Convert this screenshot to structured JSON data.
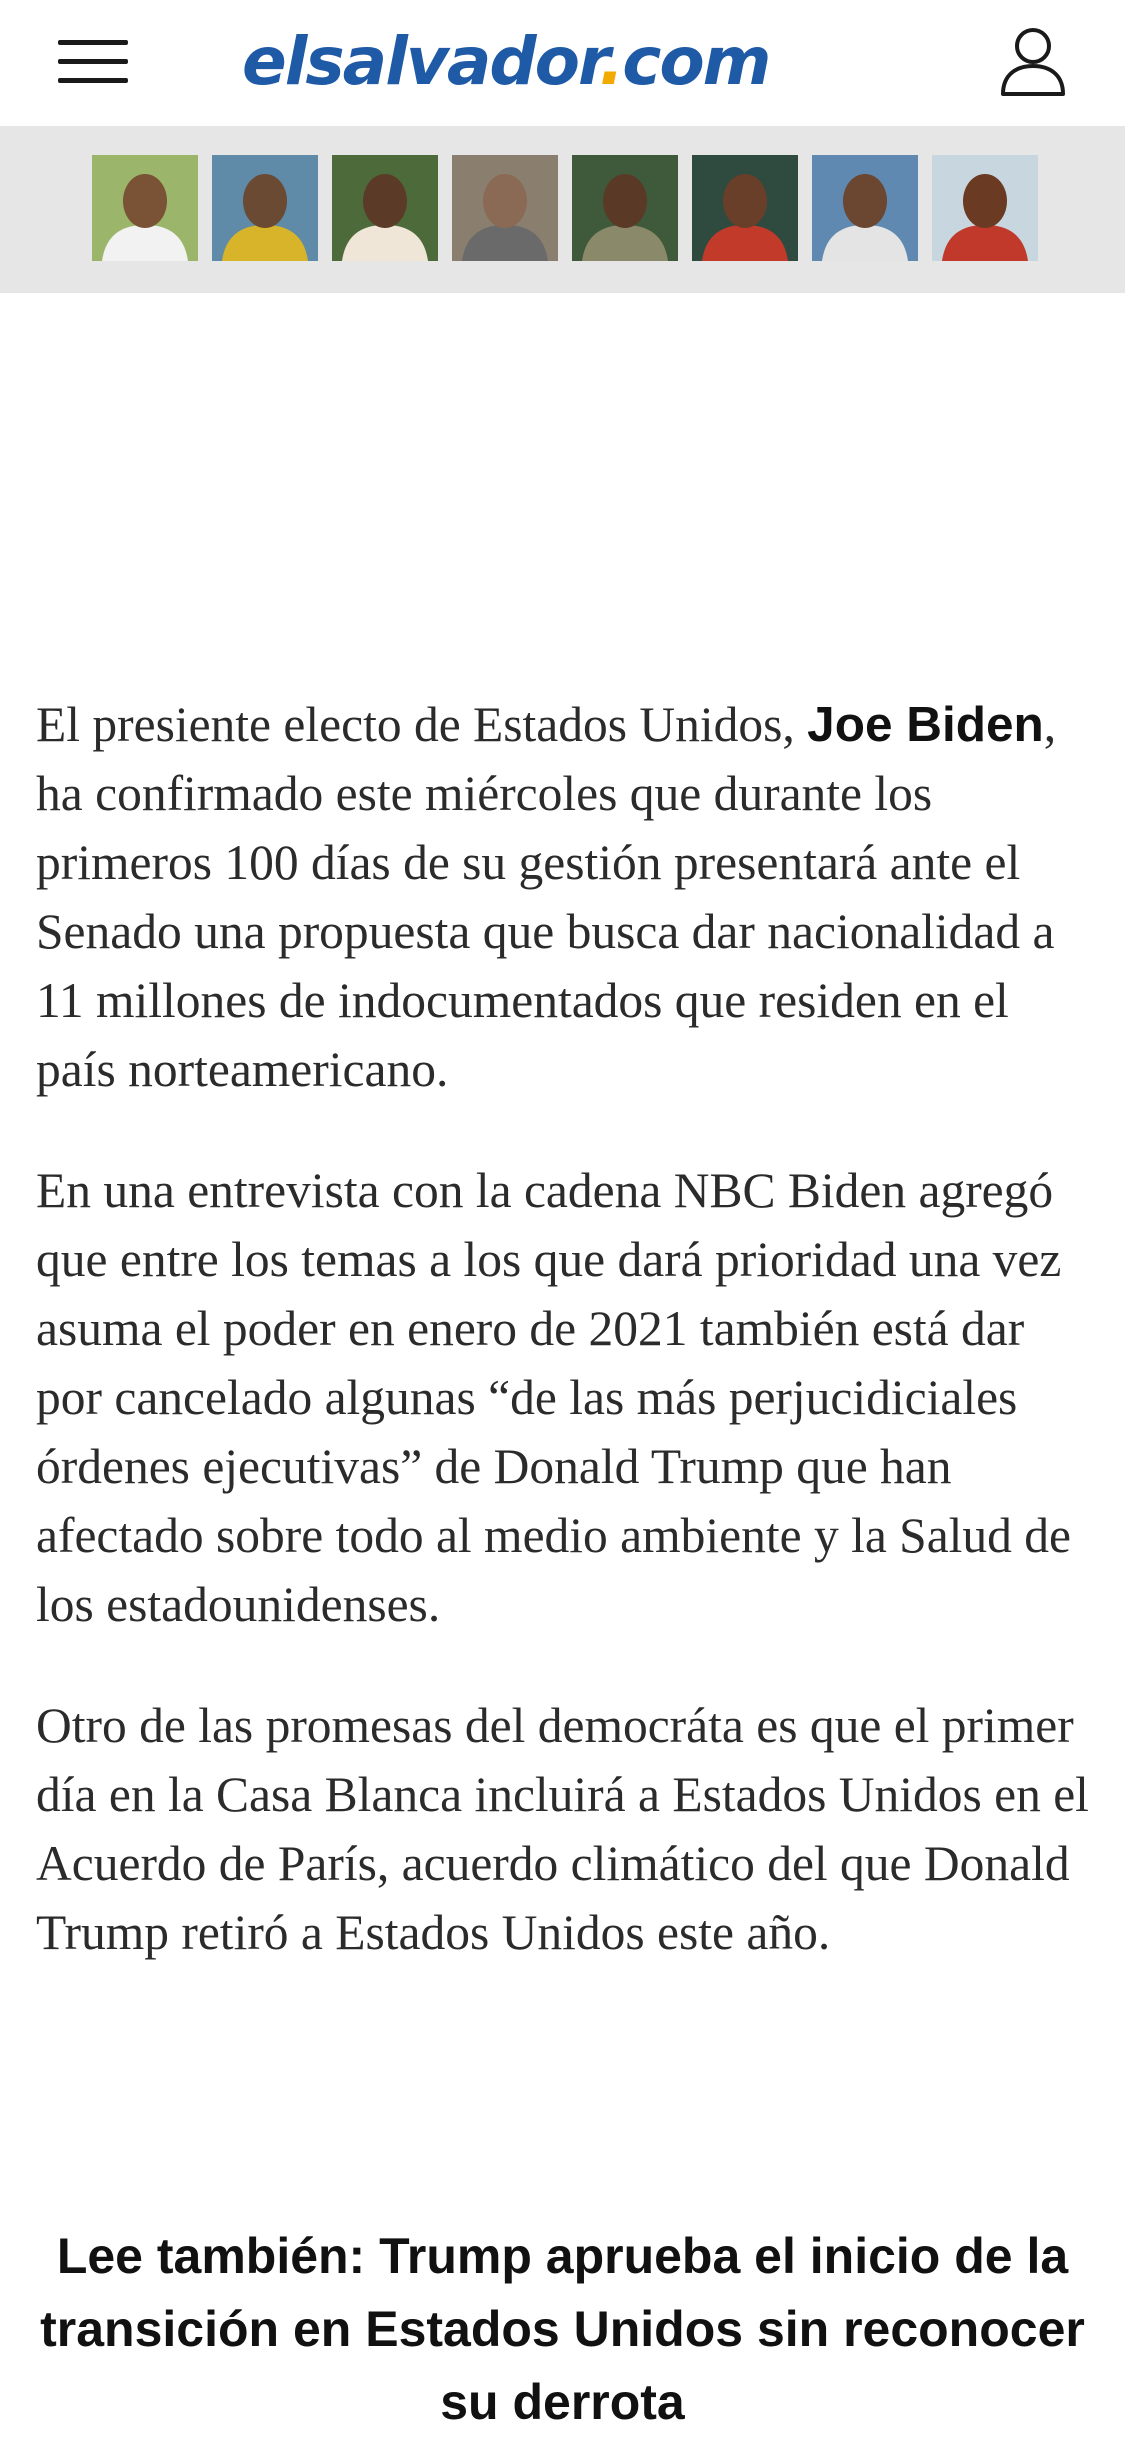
{
  "header": {
    "logo_main": "elsalvador",
    "logo_dot": ".",
    "logo_tld": "com",
    "menu_icon": "hamburger-menu-icon",
    "user_icon": "user-profile-icon"
  },
  "colors": {
    "brand": "#1f5aa6",
    "dot": "#f2a900",
    "strip_bg": "#e6e6e6",
    "body_text": "#2b2b2b"
  },
  "photo_strip": {
    "count": 8
  },
  "article": {
    "p1": {
      "before": "El presiente electo de Estados Unidos, ",
      "bold": "Joe Biden",
      "after": ", ha confirmado este miércoles que durante los primeros 100 días de su gestión presentará ante el Senado una propuesta que busca dar nacionalidad a 11 millones de indocumentados que residen en el país norteamericano."
    },
    "p2": "En una entrevista con la cadena NBC Biden agregó que entre los temas a los que dará prioridad una vez asuma el poder en enero de 2021 también está dar por cancelado algunas “de las más perjucidiciales órdenes ejecutivas” de Donald Trump que han afectado sobre todo al medio ambiente y la Salud de los estadounidenses.",
    "p3": "Otro de las promesas del democráta es que el primer día en la Casa Blanca incluirá a Estados Unidos en el Acuerdo de París, acuerdo climático del que Donald Trump retiró a Estados Unidos este año.",
    "read_also": "Lee también: Trump aprueba el inicio de la transición en Estados Unidos sin reconocer su derrota"
  }
}
